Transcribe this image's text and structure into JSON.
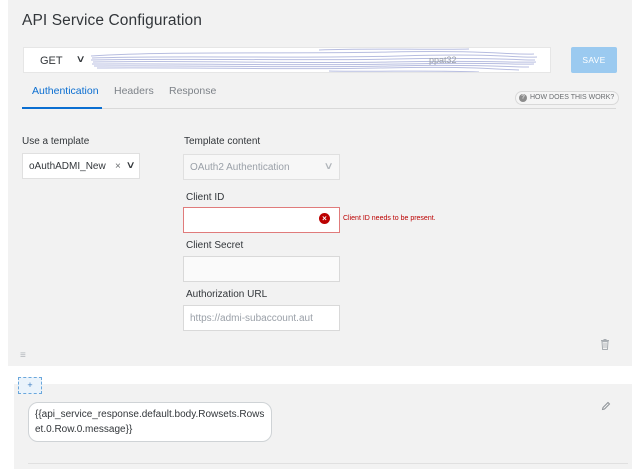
{
  "page": {
    "title": "API Service Configuration"
  },
  "request": {
    "method": "GET",
    "url_visible_fragment": "ppat32",
    "save_label": "SAVE"
  },
  "tabs": [
    {
      "label": "Authentication",
      "active": true
    },
    {
      "label": "Headers",
      "active": false
    },
    {
      "label": "Response",
      "active": false
    }
  ],
  "help": {
    "label": "HOW DOES THIS WORK?"
  },
  "template": {
    "label": "Use a template",
    "selected": "oAuthADMI_New",
    "clear_glyph": "×"
  },
  "template_content": {
    "label": "Template content",
    "selected": "OAuth2 Authentication"
  },
  "client_id": {
    "label": "Client ID",
    "value": "",
    "error": "Client ID needs to be present."
  },
  "client_secret": {
    "label": "Client Secret",
    "value": ""
  },
  "authorization_url": {
    "label": "Authorization URL",
    "value": "https://admi-subaccount.aut"
  },
  "add_button": {
    "label": "+"
  },
  "expression": {
    "text": "{{api_service_response.default.body.Rowsets.Rowset.0.Row.0.message}}"
  },
  "colors": {
    "accent": "#0a6ed1",
    "save_bg": "#9bcaf0",
    "error": "#bb0000",
    "panel_bg": "#f2f2f2"
  },
  "icons": {
    "method_dropdown": "chevron-down-icon",
    "template_dropdown": "chevron-down-icon",
    "help": "question-icon",
    "error": "error-circle-icon",
    "drag": "drag-handle-icon",
    "delete": "trash-icon",
    "edit": "pencil-icon"
  }
}
